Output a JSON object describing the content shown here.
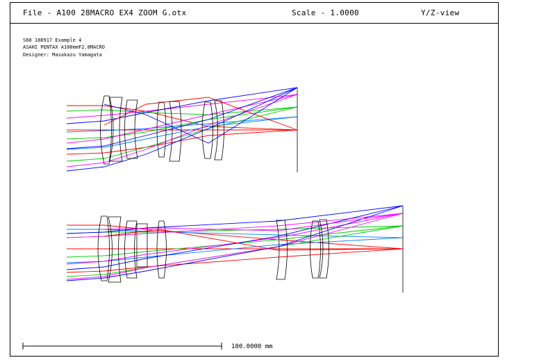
{
  "header": {
    "file": "File - A100 28MACRO EX4 ZOOM G.otx",
    "scale": "Scale - 1.0000",
    "view": "Y/Z-view"
  },
  "info": {
    "line1": "S60 188917 Example 4",
    "line2": "ASAHI PENTAX A100mmF2.8MACRO",
    "line3": "Designer: Masakazu Yamagata"
  },
  "scale_bar": {
    "label": "100.0000 mm"
  },
  "colors": {
    "ray_red": "#ff0000",
    "ray_green": "#00cc00",
    "ray_magenta": "#ff00ff",
    "ray_blue": "#0000ff",
    "ray_cyan": "#0080ff",
    "lens": "#000000"
  },
  "icons": {
    "title_bar": "none"
  }
}
